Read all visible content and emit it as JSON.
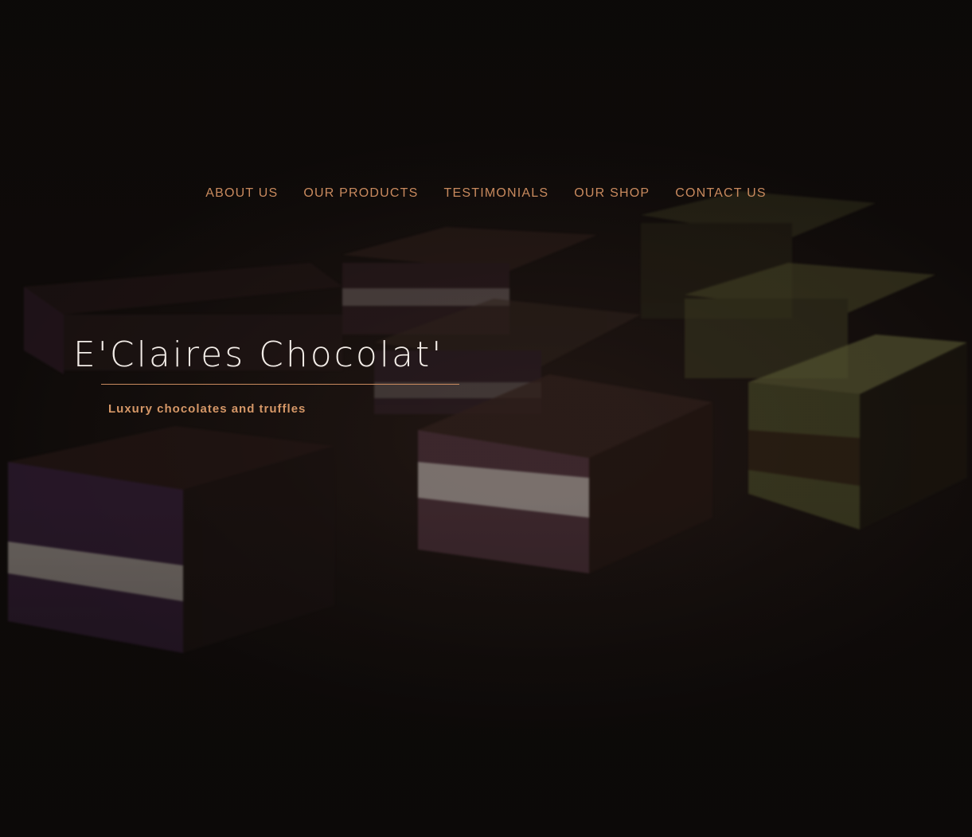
{
  "nav": {
    "items": [
      {
        "label": "ABOUT US"
      },
      {
        "label": "OUR PRODUCTS"
      },
      {
        "label": "TESTIMONIALS"
      },
      {
        "label": "OUR SHOP"
      },
      {
        "label": "CONTACT US"
      }
    ]
  },
  "hero": {
    "title": "E'Claires Chocolat'",
    "tagline": "Luxury chocolates and truffles"
  },
  "colors": {
    "accent": "#c98a5e",
    "title": "#f3ede8",
    "background": "#0d0a08"
  }
}
